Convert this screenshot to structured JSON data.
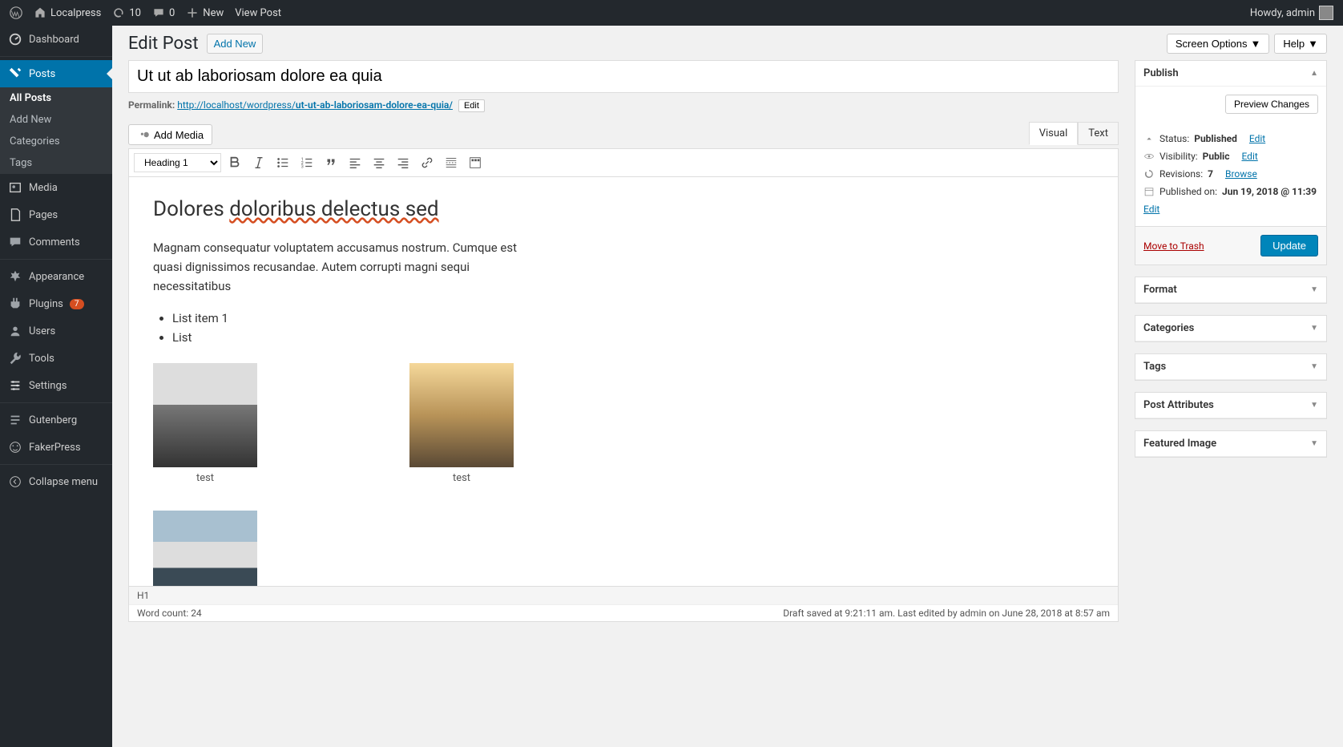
{
  "adminbar": {
    "site_name": "Localpress",
    "updates_count": "10",
    "comments_count": "0",
    "new_label": "New",
    "view_post": "View Post",
    "howdy": "Howdy, admin"
  },
  "sidebar": {
    "dashboard": "Dashboard",
    "posts": "Posts",
    "posts_sub": {
      "all": "All Posts",
      "add": "Add New",
      "cat": "Categories",
      "tags": "Tags"
    },
    "media": "Media",
    "pages": "Pages",
    "comments": "Comments",
    "appearance": "Appearance",
    "plugins": "Plugins",
    "plugins_badge": "7",
    "users": "Users",
    "tools": "Tools",
    "settings": "Settings",
    "gutenberg": "Gutenberg",
    "fakerpress": "FakerPress",
    "collapse": "Collapse menu"
  },
  "page": {
    "title": "Edit Post",
    "add_new": "Add New",
    "screen_options": "Screen Options",
    "help": "Help"
  },
  "post": {
    "title": "Ut ut ab laboriosam dolore ea quia",
    "permalink_label": "Permalink:",
    "permalink_base": "http://localhost/wordpress/",
    "permalink_slug": "ut-ut-ab-laboriosam-dolore-ea-quia/",
    "edit_slug": "Edit"
  },
  "editor": {
    "add_media": "Add Media",
    "tab_visual": "Visual",
    "tab_text": "Text",
    "format_select": "Heading 1",
    "h1_part1": "Dolores ",
    "h1_part2": "doloribus delectus sed",
    "para": "Magnam consequatur voluptatem accusamus nostrum. Cumque est quasi dignissimos recusandae. Autem corrupti magni sequi necessitatibus",
    "li1": "List item 1",
    "li2": "List",
    "caption1": "test",
    "caption2": "test",
    "footer_tag": "H1",
    "word_count_label": "Word count: ",
    "word_count": "24",
    "status_text": "Draft saved at 9:21:11 am. Last edited by admin on June 28, 2018 at 8:57 am"
  },
  "publish": {
    "title": "Publish",
    "preview": "Preview Changes",
    "status_label": "Status: ",
    "status_value": "Published",
    "edit": "Edit",
    "visibility_label": "Visibility: ",
    "visibility_value": "Public",
    "revisions_label": "Revisions: ",
    "revisions_count": "7",
    "browse": "Browse",
    "published_label": "Published on: ",
    "published_value": "Jun 19, 2018 @ 11:39",
    "trash": "Move to Trash",
    "update": "Update"
  },
  "panels": {
    "format": "Format",
    "categories": "Categories",
    "tags": "Tags",
    "attributes": "Post Attributes",
    "featured": "Featured Image"
  }
}
